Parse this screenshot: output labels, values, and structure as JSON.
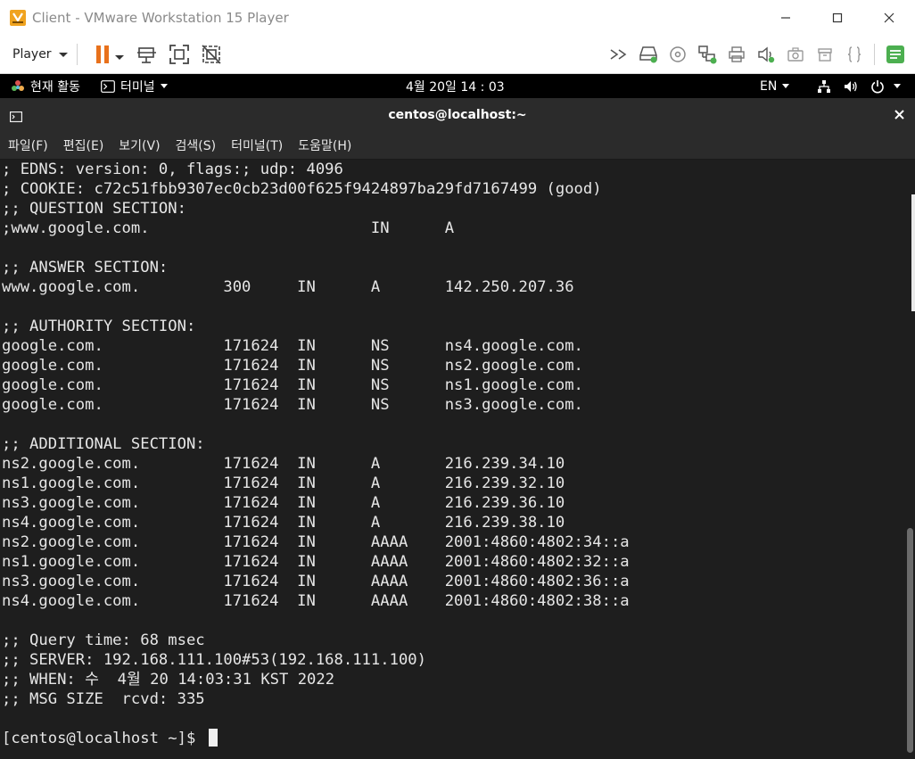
{
  "vmware": {
    "window_title": "Client - VMware Workstation 15 Player",
    "player_menu_label": "Player",
    "colors": {
      "pause": "#e8711c",
      "accent": "#4caf50"
    }
  },
  "gnome": {
    "activities": "현재 활동",
    "app_menu": "터미널",
    "clock": "4월 20일  14 : 03",
    "language": "EN"
  },
  "terminal": {
    "title": "centos@localhost:~",
    "menu": [
      "파일(F)",
      "편집(E)",
      "보기(V)",
      "검색(S)",
      "터미널(T)",
      "도움말(H)"
    ],
    "lines": [
      "; EDNS: version: 0, flags:; udp: 4096",
      "; COOKIE: c72c51fbb9307ec0cb23d00f625f9424897ba29fd7167499 (good)",
      ";; QUESTION SECTION:",
      ";www.google.com.                        IN      A",
      "",
      ";; ANSWER SECTION:",
      "www.google.com.         300     IN      A       142.250.207.36",
      "",
      ";; AUTHORITY SECTION:",
      "google.com.             171624  IN      NS      ns4.google.com.",
      "google.com.             171624  IN      NS      ns2.google.com.",
      "google.com.             171624  IN      NS      ns1.google.com.",
      "google.com.             171624  IN      NS      ns3.google.com.",
      "",
      ";; ADDITIONAL SECTION:",
      "ns2.google.com.         171624  IN      A       216.239.34.10",
      "ns1.google.com.         171624  IN      A       216.239.32.10",
      "ns3.google.com.         171624  IN      A       216.239.36.10",
      "ns4.google.com.         171624  IN      A       216.239.38.10",
      "ns2.google.com.         171624  IN      AAAA    2001:4860:4802:34::a",
      "ns1.google.com.         171624  IN      AAAA    2001:4860:4802:32::a",
      "ns3.google.com.         171624  IN      AAAA    2001:4860:4802:36::a",
      "ns4.google.com.         171624  IN      AAAA    2001:4860:4802:38::a",
      "",
      ";; Query time: 68 msec",
      ";; SERVER: 192.168.111.100#53(192.168.111.100)",
      ";; WHEN: 수  4월 20 14:03:31 KST 2022",
      ";; MSG SIZE  rcvd: 335",
      "",
      "[centos@localhost ~]$ "
    ]
  }
}
